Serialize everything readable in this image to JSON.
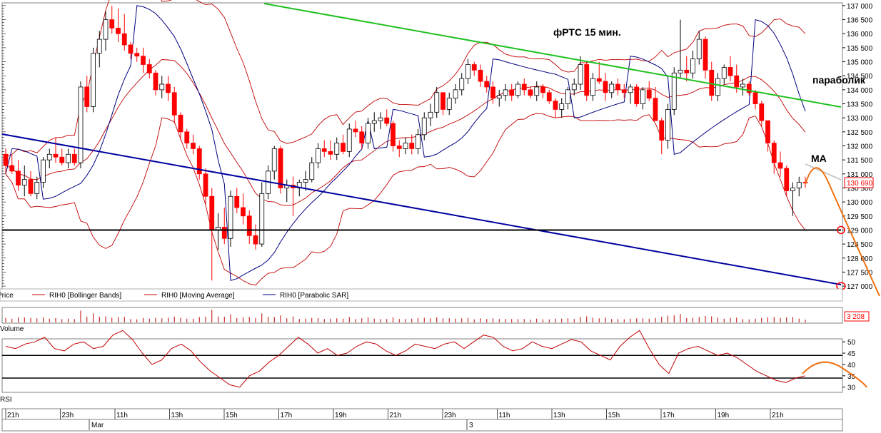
{
  "chart_data": [
    {
      "type": "candlestick",
      "title": "фРТС   15 мин.",
      "ylim": [
        126900,
        137100
      ],
      "y_ticks": [
        "137 000",
        "136 500",
        "136 000",
        "135 500",
        "135 000",
        "134 500",
        "134 000",
        "133 500",
        "133 000",
        "132 500",
        "132 000",
        "131 500",
        "131 000",
        "130 500",
        "130 000",
        "129 500",
        "129 000",
        "128 500",
        "128 000",
        "127 500",
        "127 000"
      ],
      "current_price": "130 690",
      "legend": [
        "Price",
        "RIH0 [Bollinger Bands]",
        "RIH0 [Moving Average]",
        "RIH0 [Parabolic SAR]"
      ],
      "annotations": [
        "параболик",
        "MA"
      ],
      "horizontal_levels": [
        129000
      ],
      "colors": {
        "up": "#ffffff",
        "down": "#ff0000",
        "bollinger": "#c00000",
        "ma": "#c00000",
        "sar": "#000080",
        "trend_green": "#20c020",
        "trend_blue": "#0000a0",
        "forecast": "#f07010"
      },
      "candles": [
        [
          131700,
          131900,
          131000,
          131300
        ],
        [
          131300,
          131700,
          131000,
          131100
        ],
        [
          131100,
          131500,
          130400,
          130600
        ],
        [
          130600,
          131300,
          130200,
          130800
        ],
        [
          130800,
          131100,
          130200,
          130300
        ],
        [
          130300,
          130900,
          130100,
          130700
        ],
        [
          130700,
          131600,
          130500,
          131500
        ],
        [
          131500,
          131900,
          131200,
          131700
        ],
        [
          131700,
          132300,
          131400,
          131600
        ],
        [
          131600,
          131900,
          131300,
          131400
        ],
        [
          131400,
          131900,
          131200,
          131700
        ],
        [
          131700,
          131900,
          131300,
          131400
        ],
        [
          131400,
          134300,
          131200,
          134100
        ],
        [
          134100,
          134500,
          133200,
          133400
        ],
        [
          133400,
          135500,
          133200,
          135300
        ],
        [
          135300,
          136100,
          134800,
          135800
        ],
        [
          135800,
          136800,
          135400,
          136500
        ],
        [
          136500,
          137000,
          136000,
          136200
        ],
        [
          136200,
          136900,
          135700,
          136000
        ],
        [
          136000,
          136700,
          135400,
          135600
        ],
        [
          135600,
          135700,
          135100,
          135300
        ],
        [
          135300,
          135500,
          135000,
          135200
        ],
        [
          135200,
          135500,
          134600,
          134900
        ],
        [
          134900,
          135100,
          134400,
          134600
        ],
        [
          134600,
          134700,
          133800,
          134000
        ],
        [
          134000,
          134500,
          133700,
          134200
        ],
        [
          134200,
          134500,
          133600,
          133900
        ],
        [
          133900,
          134100,
          132800,
          133100
        ],
        [
          133100,
          133200,
          132200,
          132500
        ],
        [
          132500,
          132600,
          131900,
          132100
        ],
        [
          132100,
          132400,
          131700,
          131900
        ],
        [
          131900,
          132000,
          130800,
          131000
        ],
        [
          131000,
          131200,
          129900,
          130200
        ],
        [
          130200,
          130500,
          127200,
          129000
        ],
        [
          129000,
          129600,
          128300,
          129100
        ],
        [
          129100,
          129800,
          128500,
          128700
        ],
        [
          128700,
          130400,
          128400,
          130200
        ],
        [
          130200,
          130500,
          129600,
          129800
        ],
        [
          129800,
          130300,
          129200,
          129500
        ],
        [
          129500,
          129700,
          128500,
          128800
        ],
        [
          128800,
          129200,
          128300,
          128500
        ],
        [
          128500,
          130700,
          128400,
          130300
        ],
        [
          130300,
          131300,
          130100,
          131100
        ],
        [
          131100,
          132000,
          130800,
          131900
        ],
        [
          131900,
          132000,
          130300,
          130500
        ],
        [
          130500,
          130800,
          130000,
          130600
        ],
        [
          130600,
          130900,
          129500,
          130500
        ],
        [
          130500,
          130800,
          130200,
          130700
        ],
        [
          130700,
          131100,
          130400,
          130800
        ],
        [
          130800,
          131600,
          130700,
          131400
        ],
        [
          131400,
          132100,
          131200,
          131900
        ],
        [
          131900,
          132200,
          131600,
          131800
        ],
        [
          131800,
          132200,
          131500,
          131700
        ],
        [
          131700,
          132300,
          131500,
          132100
        ],
        [
          132100,
          132400,
          131700,
          131800
        ],
        [
          131800,
          132800,
          131600,
          132600
        ],
        [
          132600,
          132900,
          132300,
          132500
        ],
        [
          132500,
          132700,
          131900,
          132100
        ],
        [
          132100,
          133000,
          131900,
          132800
        ],
        [
          132800,
          133200,
          132500,
          132900
        ],
        [
          132900,
          133200,
          132600,
          133000
        ],
        [
          133000,
          133300,
          132700,
          132800
        ],
        [
          132800,
          132900,
          131800,
          132000
        ],
        [
          132000,
          132200,
          131600,
          131900
        ],
        [
          131900,
          132300,
          131700,
          132100
        ],
        [
          132100,
          132400,
          131700,
          131900
        ],
        [
          131900,
          132600,
          131700,
          132400
        ],
        [
          132400,
          133200,
          132200,
          133000
        ],
        [
          133000,
          133500,
          132700,
          133200
        ],
        [
          133200,
          134100,
          133000,
          133900
        ],
        [
          133900,
          133900,
          133100,
          133300
        ],
        [
          133300,
          133900,
          133100,
          133700
        ],
        [
          133700,
          134200,
          133500,
          134000
        ],
        [
          134000,
          134600,
          133800,
          134400
        ],
        [
          134400,
          135100,
          134200,
          134900
        ],
        [
          134900,
          135000,
          134500,
          134700
        ],
        [
          134700,
          134900,
          134100,
          134300
        ],
        [
          134300,
          134500,
          133900,
          134100
        ],
        [
          134100,
          134300,
          133500,
          133700
        ],
        [
          133700,
          134000,
          133400,
          133800
        ],
        [
          133800,
          134200,
          133600,
          134000
        ],
        [
          134000,
          134200,
          133600,
          133800
        ],
        [
          133800,
          134300,
          133700,
          134200
        ],
        [
          134200,
          134400,
          133800,
          134000
        ],
        [
          134000,
          134100,
          133700,
          133800
        ],
        [
          133800,
          134300,
          133600,
          134100
        ],
        [
          134100,
          134200,
          133700,
          133900
        ],
        [
          133900,
          134000,
          133500,
          133600
        ],
        [
          133600,
          133700,
          133000,
          133300
        ],
        [
          133300,
          133700,
          133000,
          133500
        ],
        [
          133500,
          134100,
          133300,
          134000
        ],
        [
          134000,
          134400,
          133800,
          134200
        ],
        [
          134200,
          135200,
          134000,
          134900
        ],
        [
          134900,
          135000,
          133600,
          133800
        ],
        [
          133800,
          134600,
          133600,
          134400
        ],
        [
          134400,
          135000,
          134200,
          134300
        ],
        [
          134300,
          134600,
          133600,
          133900
        ],
        [
          133900,
          134300,
          133700,
          134200
        ],
        [
          134200,
          134400,
          133800,
          134000
        ],
        [
          134000,
          134200,
          133700,
          133900
        ],
        [
          133900,
          134200,
          133500,
          134100
        ],
        [
          134100,
          134200,
          133400,
          133500
        ],
        [
          133500,
          134100,
          133300,
          134000
        ],
        [
          134000,
          134300,
          133600,
          133700
        ],
        [
          133700,
          134100,
          133200,
          132900
        ],
        [
          132900,
          133000,
          131700,
          132200
        ],
        [
          132200,
          133500,
          131900,
          133300
        ],
        [
          133300,
          134800,
          133100,
          134600
        ],
        [
          134600,
          136500,
          134400,
          134700
        ],
        [
          134700,
          135200,
          134300,
          134600
        ],
        [
          134600,
          135400,
          134400,
          135100
        ],
        [
          135100,
          136100,
          134900,
          135800
        ],
        [
          135800,
          135900,
          134400,
          134700
        ],
        [
          134700,
          135000,
          133600,
          133800
        ],
        [
          133800,
          134600,
          133600,
          134400
        ],
        [
          134400,
          134900,
          134200,
          134800
        ],
        [
          134800,
          135200,
          134300,
          134500
        ],
        [
          134500,
          134900,
          133900,
          134100
        ],
        [
          134100,
          134400,
          133800,
          134200
        ],
        [
          134200,
          134300,
          133800,
          133900
        ],
        [
          133900,
          134000,
          133300,
          133500
        ],
        [
          133500,
          133600,
          132700,
          132900
        ],
        [
          132900,
          132900,
          131800,
          132100
        ],
        [
          132100,
          132200,
          131000,
          131400
        ],
        [
          131400,
          131800,
          130900,
          131200
        ],
        [
          131200,
          131300,
          130200,
          130400
        ],
        [
          130400,
          130700,
          129500,
          130500
        ],
        [
          130500,
          130900,
          130200,
          130700
        ],
        [
          130700,
          130900,
          130500,
          130690
        ]
      ],
      "x_labels": [
        "21h",
        "23h",
        "11h",
        "13h",
        "15h",
        "17h",
        "19h",
        "21h",
        "23h",
        "11h",
        "13h",
        "15h",
        "17h",
        "19h",
        "21h"
      ],
      "x_sublabels": [
        "Mar",
        "3"
      ]
    },
    {
      "type": "bar",
      "title": "Volume",
      "last_value": "3 208"
    },
    {
      "type": "line",
      "title": "RSI",
      "y_ticks": [
        "50",
        "45",
        "40",
        "35",
        "30"
      ],
      "ylim": [
        28,
        51
      ],
      "levels": [
        44,
        34
      ],
      "values": [
        48,
        47,
        49,
        50,
        52,
        47,
        46,
        49,
        50,
        47,
        48,
        53,
        55,
        51,
        45,
        40,
        42,
        47,
        49,
        46,
        41,
        37,
        34,
        31,
        30,
        35,
        37,
        41,
        44,
        48,
        52,
        49,
        45,
        47,
        44,
        45,
        48,
        50,
        49,
        46,
        44,
        46,
        49,
        48,
        47,
        49,
        50,
        47,
        50,
        53,
        52,
        48,
        46,
        47,
        50,
        48,
        47,
        49,
        51,
        50,
        46,
        44,
        42,
        48,
        52,
        55,
        47,
        40,
        36,
        45,
        47,
        48,
        46,
        44,
        45,
        43,
        40,
        37,
        35,
        33,
        32,
        34,
        35
      ]
    }
  ],
  "legend_bar": {
    "items": [
      "Price",
      "RIH0 [Bollinger Bands]",
      "RIH0 [Moving Average]",
      "RIH0 [Parabolic SAR]"
    ]
  }
}
